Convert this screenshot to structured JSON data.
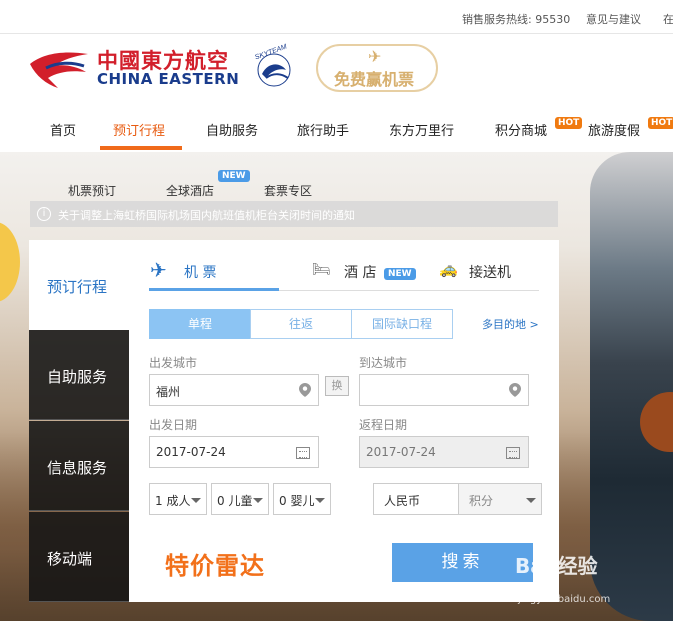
{
  "topbar": {
    "hotline": "销售服务热线: 95530",
    "feedback": "意见与建议",
    "more": "在"
  },
  "brand": {
    "name_cn": "中國東方航空",
    "name_en": "CHINA EASTERN",
    "alliance": "SKYTEAM",
    "promo": "免费赢机票"
  },
  "nav": {
    "items": [
      "首页",
      "预订行程",
      "自助服务",
      "旅行助手",
      "东方万里行",
      "积分商城",
      "旅游度假"
    ],
    "hot": "HOT"
  },
  "subnav": {
    "items": [
      "机票预订",
      "全球酒店",
      "套票专区"
    ],
    "new": "NEW"
  },
  "notice": {
    "icon": "i",
    "text": "关于调整上海虹桥国际机场国内航班值机柜台关闭时间的通知"
  },
  "side_tabs": [
    "预订行程",
    "自助服务",
    "信息服务",
    "移动端"
  ],
  "panel": {
    "tabs": [
      "机 票",
      "酒 店",
      "接送机"
    ],
    "new": "NEW",
    "trip_types": [
      "单程",
      "往返",
      "国际缺口程"
    ],
    "multi_dest": "多目的地 >",
    "from_label": "出发城市",
    "from_value": "福州",
    "to_label": "到达城市",
    "to_value": "",
    "swap": "换",
    "depart_label": "出发日期",
    "depart_value": "2017-07-24",
    "return_label": "返程日期",
    "return_value": "2017-07-24",
    "adults": "1 成人",
    "children": "0 儿童",
    "infants": "0 婴儿",
    "currency": "人民币",
    "points": "积分",
    "special": "特价雷达",
    "search": "搜索"
  },
  "watermark": {
    "main": "Bai 经验",
    "sub": "jingyan.baidu.com"
  },
  "colors": {
    "brand_red": "#d21f2b",
    "brand_blue": "#1a3c8c",
    "accent_orange": "#f06a1a",
    "primary_blue": "#5aa2e6"
  }
}
